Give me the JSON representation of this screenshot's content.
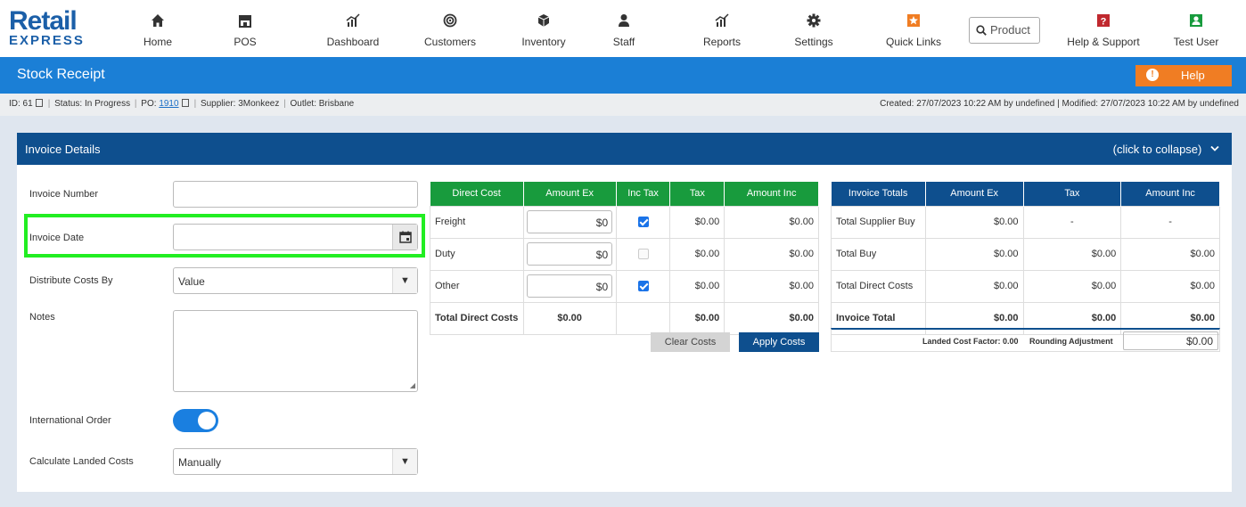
{
  "brand": {
    "line1": "Retail",
    "line2": "EXPRESS"
  },
  "nav": [
    {
      "label": "Home",
      "icon": "home-icon"
    },
    {
      "label": "POS",
      "icon": "store-icon"
    },
    {
      "label": "Dashboard",
      "icon": "chart-icon"
    },
    {
      "label": "Customers",
      "icon": "target-icon"
    },
    {
      "label": "Inventory",
      "icon": "box-icon"
    },
    {
      "label": "Staff",
      "icon": "user-icon"
    },
    {
      "label": "Reports",
      "icon": "chart-icon"
    },
    {
      "label": "Settings",
      "icon": "gear-icon"
    },
    {
      "label": "Quick Links",
      "icon": "star-icon"
    },
    {
      "label": "Help & Support",
      "icon": "question-icon"
    },
    {
      "label": "Test User",
      "icon": "user-icon"
    }
  ],
  "product_search": {
    "placeholder": "Product"
  },
  "page": {
    "title": "Stock Receipt",
    "help": "Help"
  },
  "info": {
    "id": "ID: 61",
    "status": "Status: In Progress",
    "po_label": "PO:",
    "po_value": "1910",
    "supplier": "Supplier: 3Monkeez",
    "outlet": "Outlet: Brisbane",
    "created": "Created: 27/07/2023 10:22 AM by undefined | Modified: 27/07/2023 10:22 AM by undefined"
  },
  "panel": {
    "title": "Invoice Details",
    "collapse": "(click to collapse)"
  },
  "form": {
    "invoice_number": {
      "label": "Invoice Number",
      "value": ""
    },
    "invoice_date": {
      "label": "Invoice Date",
      "value": ""
    },
    "distribute": {
      "label": "Distribute Costs By",
      "value": "Value"
    },
    "notes": {
      "label": "Notes",
      "value": ""
    },
    "international": {
      "label": "International Order",
      "on": true
    },
    "landed": {
      "label": "Calculate Landed Costs",
      "value": "Manually"
    }
  },
  "direct_costs": {
    "headers": [
      "Direct Cost",
      "Amount Ex",
      "Inc Tax",
      "Tax",
      "Amount Inc"
    ],
    "rows": [
      {
        "name": "Freight",
        "amount_ex": "$0",
        "inc_tax": true,
        "tax": "$0.00",
        "amount_inc": "$0.00"
      },
      {
        "name": "Duty",
        "amount_ex": "$0",
        "inc_tax": false,
        "tax": "$0.00",
        "amount_inc": "$0.00"
      },
      {
        "name": "Other",
        "amount_ex": "$0",
        "inc_tax": true,
        "tax": "$0.00",
        "amount_inc": "$0.00"
      }
    ],
    "total": {
      "name": "Total Direct Costs",
      "amount_ex": "$0.00",
      "tax": "$0.00",
      "amount_inc": "$0.00"
    },
    "clear_label": "Clear Costs",
    "apply_label": "Apply Costs"
  },
  "invoice_totals": {
    "headers": [
      "Invoice Totals",
      "Amount Ex",
      "Tax",
      "Amount Inc"
    ],
    "rows": [
      {
        "name": "Total Supplier Buy",
        "amount_ex": "$0.00",
        "tax": "-",
        "amount_inc": "-"
      },
      {
        "name": "Total Buy",
        "amount_ex": "$0.00",
        "tax": "$0.00",
        "amount_inc": "$0.00"
      },
      {
        "name": "Total Direct Costs",
        "amount_ex": "$0.00",
        "tax": "$0.00",
        "amount_inc": "$0.00"
      }
    ],
    "total": {
      "name": "Invoice Total",
      "amount_ex": "$0.00",
      "tax": "$0.00",
      "amount_inc": "$0.00"
    },
    "landed_factor": "Landed Cost Factor: 0.00",
    "rounding_label": "Rounding Adjustment",
    "rounding_value": "$0.00"
  },
  "colors": {
    "nav_blue": "#1b7fd6",
    "header_navy": "#0e4f8e",
    "green_header": "#189b3d",
    "help_orange": "#f07d23",
    "highlight": "#22ee22"
  }
}
